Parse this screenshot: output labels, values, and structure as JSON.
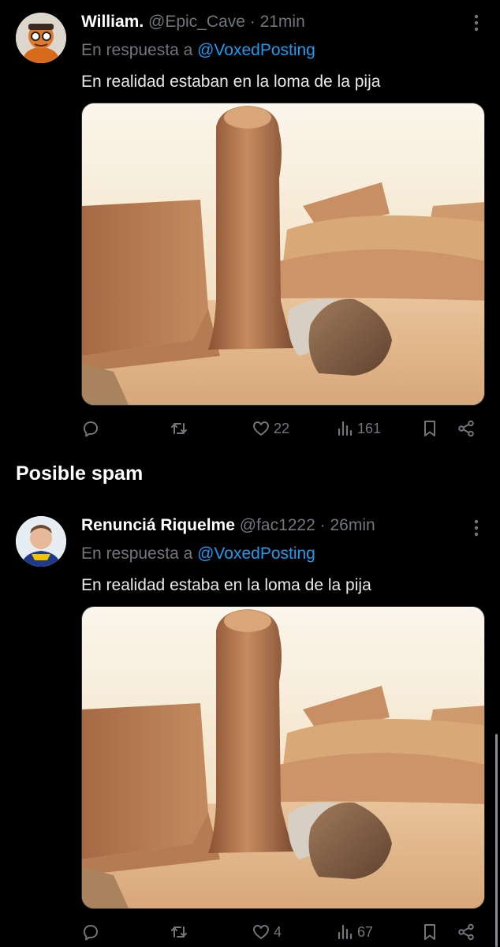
{
  "tweets": [
    {
      "name": "William.",
      "handle": "@Epic_Cave",
      "sep": "·",
      "time": "21min",
      "reply_prefix": "En respuesta a",
      "reply_to": "@VoxedPosting",
      "text": "En realidad estaban en la loma de la pija",
      "replies": "",
      "reposts": "",
      "likes": "22",
      "views": "161"
    },
    {
      "name": "Renunciá Riquelme",
      "handle": "@fac1222",
      "sep": "·",
      "time": "26min",
      "reply_prefix": "En respuesta a",
      "reply_to": "@VoxedPosting",
      "text": "En realidad estaba en la loma de la pija",
      "replies": "",
      "reposts": "",
      "likes": "4",
      "views": "67"
    }
  ],
  "section": {
    "title": "Posible spam"
  },
  "icons": {
    "reply": "reply-icon",
    "repost": "repost-icon",
    "like": "heart-icon",
    "views": "views-icon",
    "bookmark": "bookmark-icon",
    "share": "share-icon",
    "more": "more-vertical-icon"
  },
  "colors": {
    "background": "#000000",
    "link": "#1d9bf0",
    "muted": "#71767b",
    "text": "#e7e9ea"
  }
}
